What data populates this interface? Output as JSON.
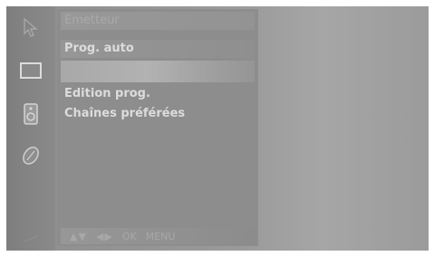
{
  "menu": {
    "items": [
      {
        "label": "Emetteur"
      },
      {
        "label": "Prog. auto"
      },
      {
        "label": ""
      },
      {
        "label": "Edition prog."
      },
      {
        "label": "Chaînes préférées"
      }
    ]
  },
  "footer": {
    "updown": "▲▼",
    "leftright": "◀▶",
    "ok": "OK",
    "menu": "MENU"
  },
  "sidebar": {
    "icons": [
      "cursor-icon",
      "screen-icon",
      "speaker-icon",
      "setup-icon"
    ]
  }
}
